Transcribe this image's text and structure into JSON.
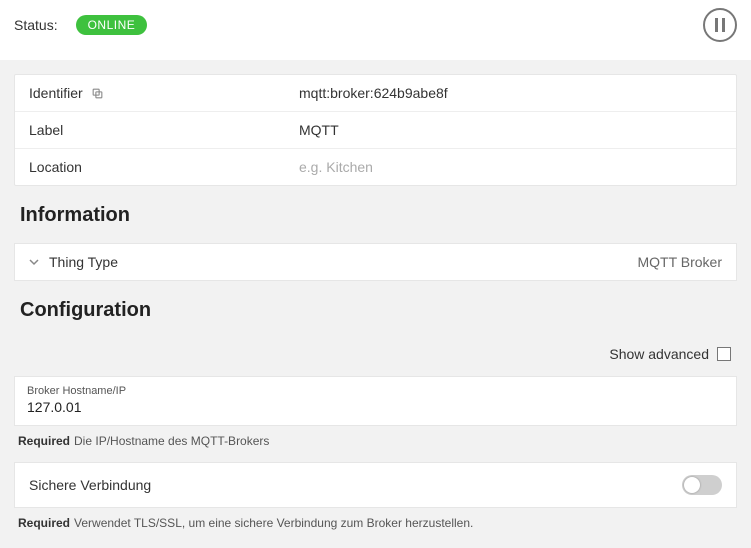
{
  "status": {
    "label": "Status:",
    "badge": "ONLINE"
  },
  "props": {
    "identifier": {
      "key": "Identifier",
      "value": "mqtt:broker:624b9abe8f"
    },
    "label": {
      "key": "Label",
      "value": "MQTT"
    },
    "location": {
      "key": "Location",
      "placeholder": "e.g. Kitchen"
    }
  },
  "sections": {
    "information": "Information",
    "configuration": "Configuration"
  },
  "thingType": {
    "label": "Thing Type",
    "value": "MQTT Broker"
  },
  "advanced": {
    "label": "Show advanced",
    "checked": false
  },
  "config": {
    "hostname": {
      "label": "Broker Hostname/IP",
      "value": "127.0.01",
      "help_required": "Required",
      "help_text": "Die IP/Hostname des MQTT-Brokers"
    },
    "secure": {
      "label": "Sichere Verbindung",
      "help_required": "Required",
      "help_text": "Verwendet TLS/SSL, um eine sichere Verbindung zum Broker herzustellen.",
      "enabled": false
    }
  }
}
